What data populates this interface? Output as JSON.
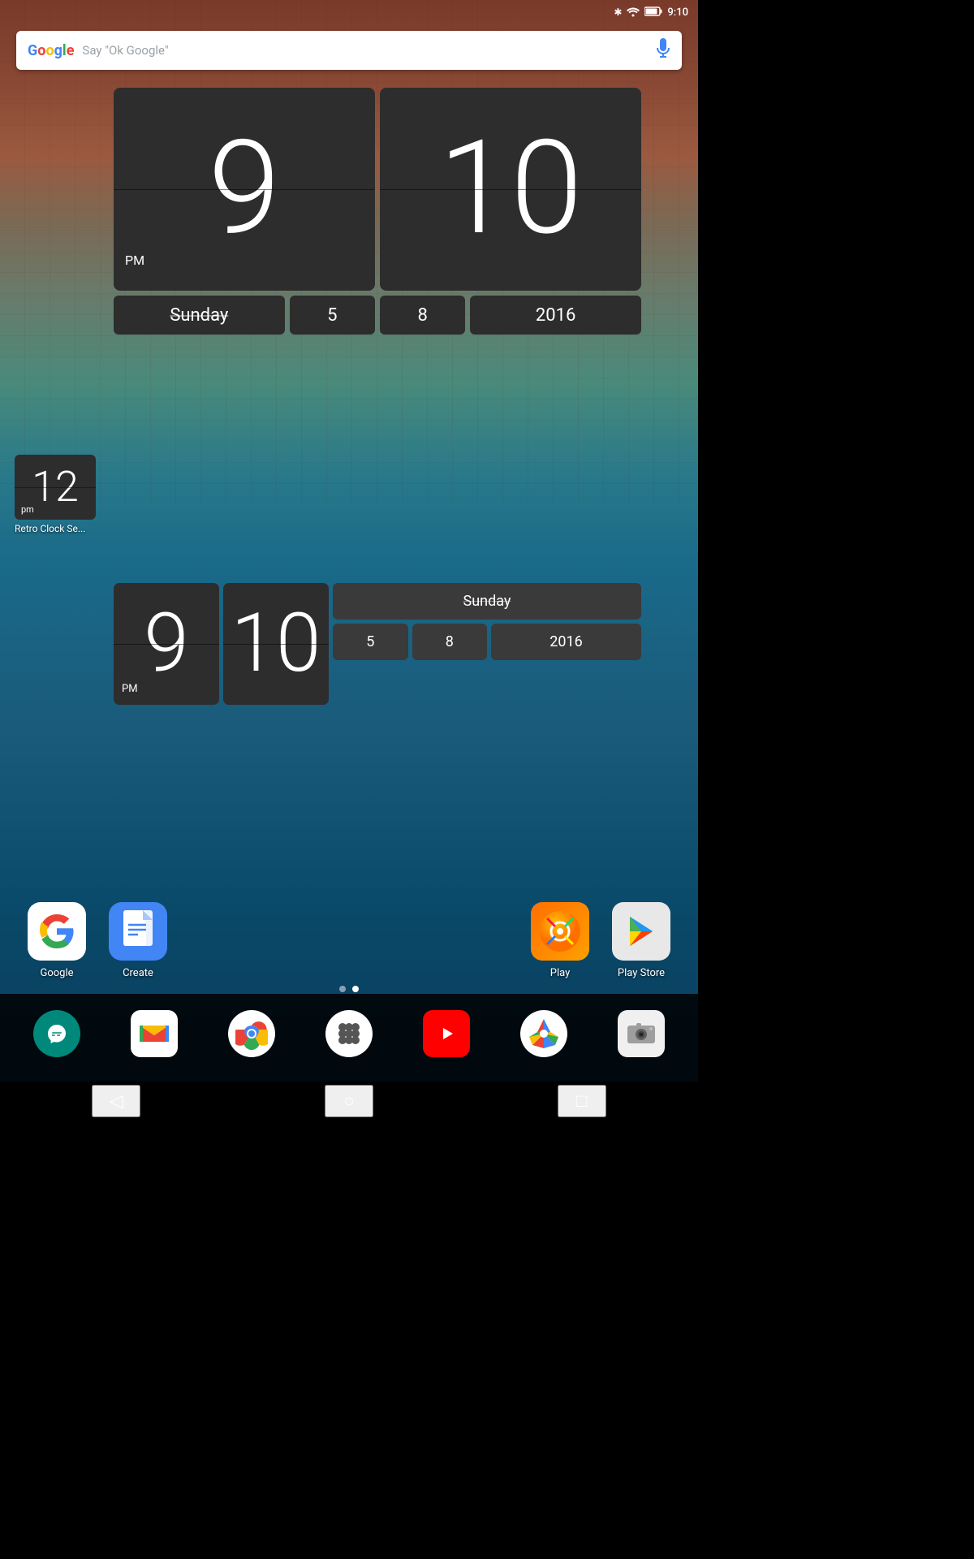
{
  "statusBar": {
    "time": "9:10",
    "icons": [
      "bluetooth",
      "wifi",
      "battery"
    ]
  },
  "searchBar": {
    "logo": "Google",
    "placeholder": "Say \"Ok Google\"",
    "micLabel": "mic"
  },
  "clockLarge": {
    "hour": "9",
    "minute": "10",
    "ampm": "PM",
    "dayOfWeek": "Sunday",
    "month": "5",
    "day": "8",
    "year": "2016"
  },
  "clockSmall": {
    "number": "12",
    "ampm": "pm",
    "label": "Retro Clock Se..."
  },
  "clockMedium": {
    "hour": "9",
    "minute": "10",
    "ampm": "PM",
    "dayOfWeek": "Sunday",
    "month": "5",
    "day": "8",
    "year": "2016"
  },
  "appIcons": [
    {
      "name": "Google",
      "type": "google"
    },
    {
      "name": "Create",
      "type": "create"
    },
    {
      "name": "Play",
      "type": "play"
    },
    {
      "name": "Play Store",
      "type": "playstore"
    }
  ],
  "pageIndicators": [
    {
      "active": false
    },
    {
      "active": true
    }
  ],
  "dock": [
    {
      "name": "Hangouts",
      "type": "hangouts"
    },
    {
      "name": "Gmail",
      "type": "gmail"
    },
    {
      "name": "Chrome",
      "type": "chrome"
    },
    {
      "name": "Apps",
      "type": "apps"
    },
    {
      "name": "YouTube",
      "type": "youtube"
    },
    {
      "name": "Photos",
      "type": "photos"
    },
    {
      "name": "Camera",
      "type": "camera"
    }
  ],
  "navBar": {
    "back": "◁",
    "home": "○",
    "recents": "□"
  }
}
